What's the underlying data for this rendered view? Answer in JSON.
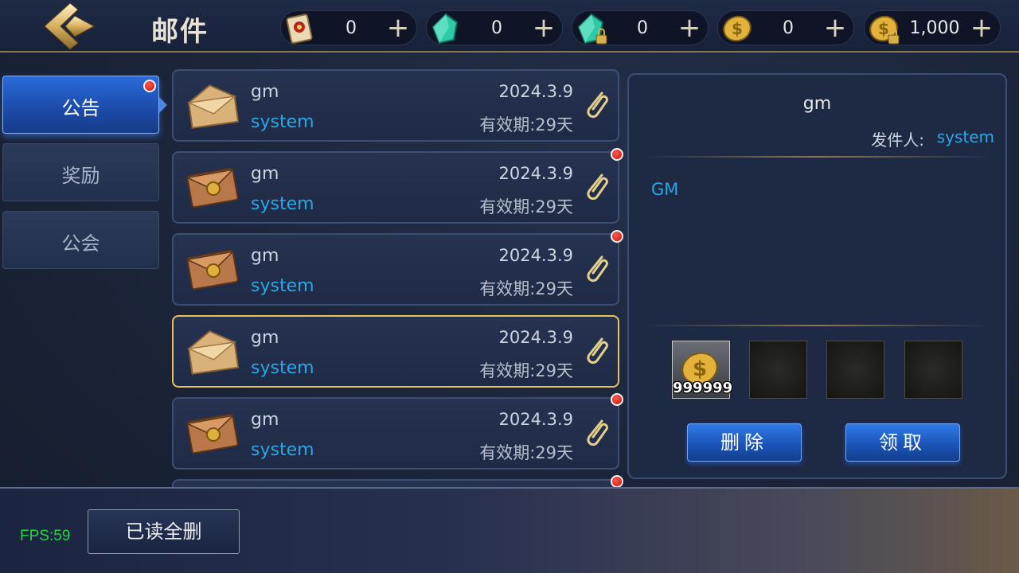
{
  "header": {
    "title": "邮件",
    "back_icon": "back-arrow-icon"
  },
  "resources": [
    {
      "icon": "scroll-icon",
      "value": "0"
    },
    {
      "icon": "green-gem-icon",
      "value": "0"
    },
    {
      "icon": "locked-green-gem-icon",
      "value": "0"
    },
    {
      "icon": "gold-coin-icon",
      "value": "0"
    },
    {
      "icon": "locked-gold-coin-icon",
      "value": "1,000"
    }
  ],
  "plus_symbol": "+",
  "tabs": [
    {
      "label": "公告",
      "active": true,
      "has_dot": true
    },
    {
      "label": "奖励",
      "active": false,
      "has_dot": false
    },
    {
      "label": "公会",
      "active": false,
      "has_dot": false
    }
  ],
  "mails": [
    {
      "sender": "gm",
      "from": "system",
      "date": "2024.3.9",
      "expire": "有效期:29天",
      "icon": "opened-envelope-icon",
      "unread": false,
      "selected": false
    },
    {
      "sender": "gm",
      "from": "system",
      "date": "2024.3.9",
      "expire": "有效期:29天",
      "icon": "sealed-envelope-icon",
      "unread": true,
      "selected": false
    },
    {
      "sender": "gm",
      "from": "system",
      "date": "2024.3.9",
      "expire": "有效期:29天",
      "icon": "sealed-envelope-icon",
      "unread": true,
      "selected": false
    },
    {
      "sender": "gm",
      "from": "system",
      "date": "2024.3.9",
      "expire": "有效期:29天",
      "icon": "opened-envelope-icon",
      "unread": false,
      "selected": true
    },
    {
      "sender": "gm",
      "from": "system",
      "date": "2024.3.9",
      "expire": "有效期:29天",
      "icon": "sealed-envelope-icon",
      "unread": true,
      "selected": false
    },
    {
      "sender": "",
      "from": "",
      "date": "",
      "expire": "",
      "icon": "sealed-envelope-icon",
      "unread": true,
      "selected": false
    }
  ],
  "detail": {
    "title": "gm",
    "sender_label": "发件人:",
    "sender_value": "system",
    "body": "GM",
    "attachments": [
      {
        "icon": "gold-coin-icon",
        "count": "999999"
      },
      {
        "icon": "",
        "count": ""
      },
      {
        "icon": "",
        "count": ""
      },
      {
        "icon": "",
        "count": ""
      }
    ],
    "delete_label": "删除",
    "claim_label": "领取"
  },
  "footer": {
    "fps": "FPS:59",
    "delete_read_label": "已读全删"
  },
  "colors": {
    "accent_blue": "#29a7e6",
    "gold_border": "#e8c25a",
    "fps_green": "#22d83a",
    "unread_dot": "#c2120a"
  }
}
